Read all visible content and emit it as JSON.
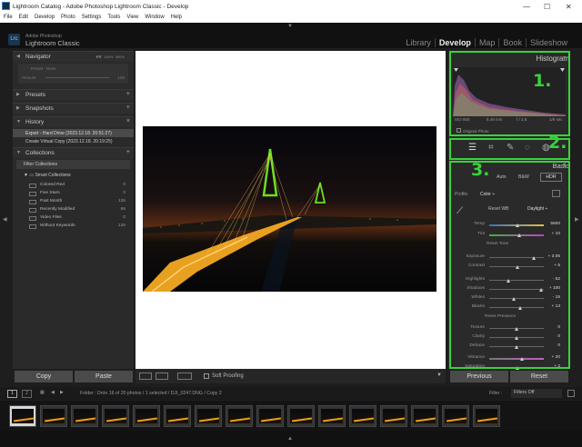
{
  "window": {
    "title": "Lightroom Catalog - Adobe Photoshop Lightroom Classic - Develop",
    "app_icon": "Lr",
    "minimize": "—",
    "maximize": "☐",
    "close": "✕"
  },
  "menu": [
    "File",
    "Edit",
    "Develop",
    "Photo",
    "Settings",
    "Tools",
    "View",
    "Window",
    "Help"
  ],
  "identity": {
    "logo": "Lrc",
    "line1": "Adobe Photoshop",
    "line2": "Lightroom Classic"
  },
  "modules": [
    "Library",
    "Develop",
    "Map",
    "Book",
    "Slideshow"
  ],
  "left": {
    "navigator": "Navigator",
    "navigator_opts": [
      "FIT",
      "100%",
      "300%"
    ],
    "preset_label": "Preset : None",
    "amount_label": "Amount",
    "amount_value": "100",
    "presets": "Presets",
    "snapshots": "Snapshots",
    "history": "History",
    "history_items": [
      "Export - Hard Drive (2023.12.18. 20:51:27)",
      "Create Virtual Copy (2023.12.18. 20:19:25)"
    ],
    "collections": "Collections",
    "filter_collections": "Filter Collections",
    "smart_collections": "Smart Collections",
    "collection_items": [
      {
        "name": "Colored Red",
        "count": "0"
      },
      {
        "name": "Five Stars",
        "count": "0"
      },
      {
        "name": "Past Month",
        "count": "135"
      },
      {
        "name": "Recently Modified",
        "count": "86"
      },
      {
        "name": "Video Files",
        "count": "0"
      },
      {
        "name": "Without Keywords",
        "count": "135"
      }
    ],
    "copy": "Copy",
    "paste": "Paste"
  },
  "toolbar": {
    "soft_proofing": "Soft Proofing"
  },
  "right": {
    "histogram": "Histogram",
    "iso": "ISO 800",
    "focal": "6.49 mm",
    "aperture": "f / 2.8",
    "shutter": "1/8 sec",
    "original_photo": "Original Photo",
    "basic": "Basic",
    "treatments": [
      "Auto",
      "B&W",
      "HDR"
    ],
    "profile_label": "Profile",
    "profile_value": "Color ÷",
    "wb_label": "Reset WB",
    "wb_value": "Daylight ÷",
    "tone_label": "Reset Tone",
    "presence_label": "Reset Presence",
    "sliders": [
      {
        "name": "Temp",
        "value": "5500"
      },
      {
        "name": "Tint",
        "value": "+ 10"
      },
      {
        "name": "Exposure",
        "value": "+ 3.05"
      },
      {
        "name": "Contrast",
        "value": "+ 5"
      },
      {
        "name": "Highlights",
        "value": "- 52"
      },
      {
        "name": "Shadows",
        "value": "+ 100"
      },
      {
        "name": "Whites",
        "value": "- 15"
      },
      {
        "name": "Blacks",
        "value": "+ 13"
      },
      {
        "name": "Texture",
        "value": "0"
      },
      {
        "name": "Clarity",
        "value": "0"
      },
      {
        "name": "Dehaze",
        "value": "0"
      },
      {
        "name": "Vibrance",
        "value": "+ 20"
      },
      {
        "name": "Saturation",
        "value": "+ 2"
      }
    ],
    "previous": "Previous",
    "reset": "Reset"
  },
  "annotations": [
    "1.",
    "2.",
    "3."
  ],
  "filmstrip": {
    "page1": "1",
    "page2": "2",
    "info": "Folder : Drón     16 of 20 photos / 1 selected / DJI_0247.DNG / Copy 2",
    "filter_label": "Filter :",
    "filter_value": "Filters Off"
  },
  "colors": {
    "highlight": "#39d23c",
    "panel": "#2a2a2a",
    "background": "#1e1e1e"
  }
}
